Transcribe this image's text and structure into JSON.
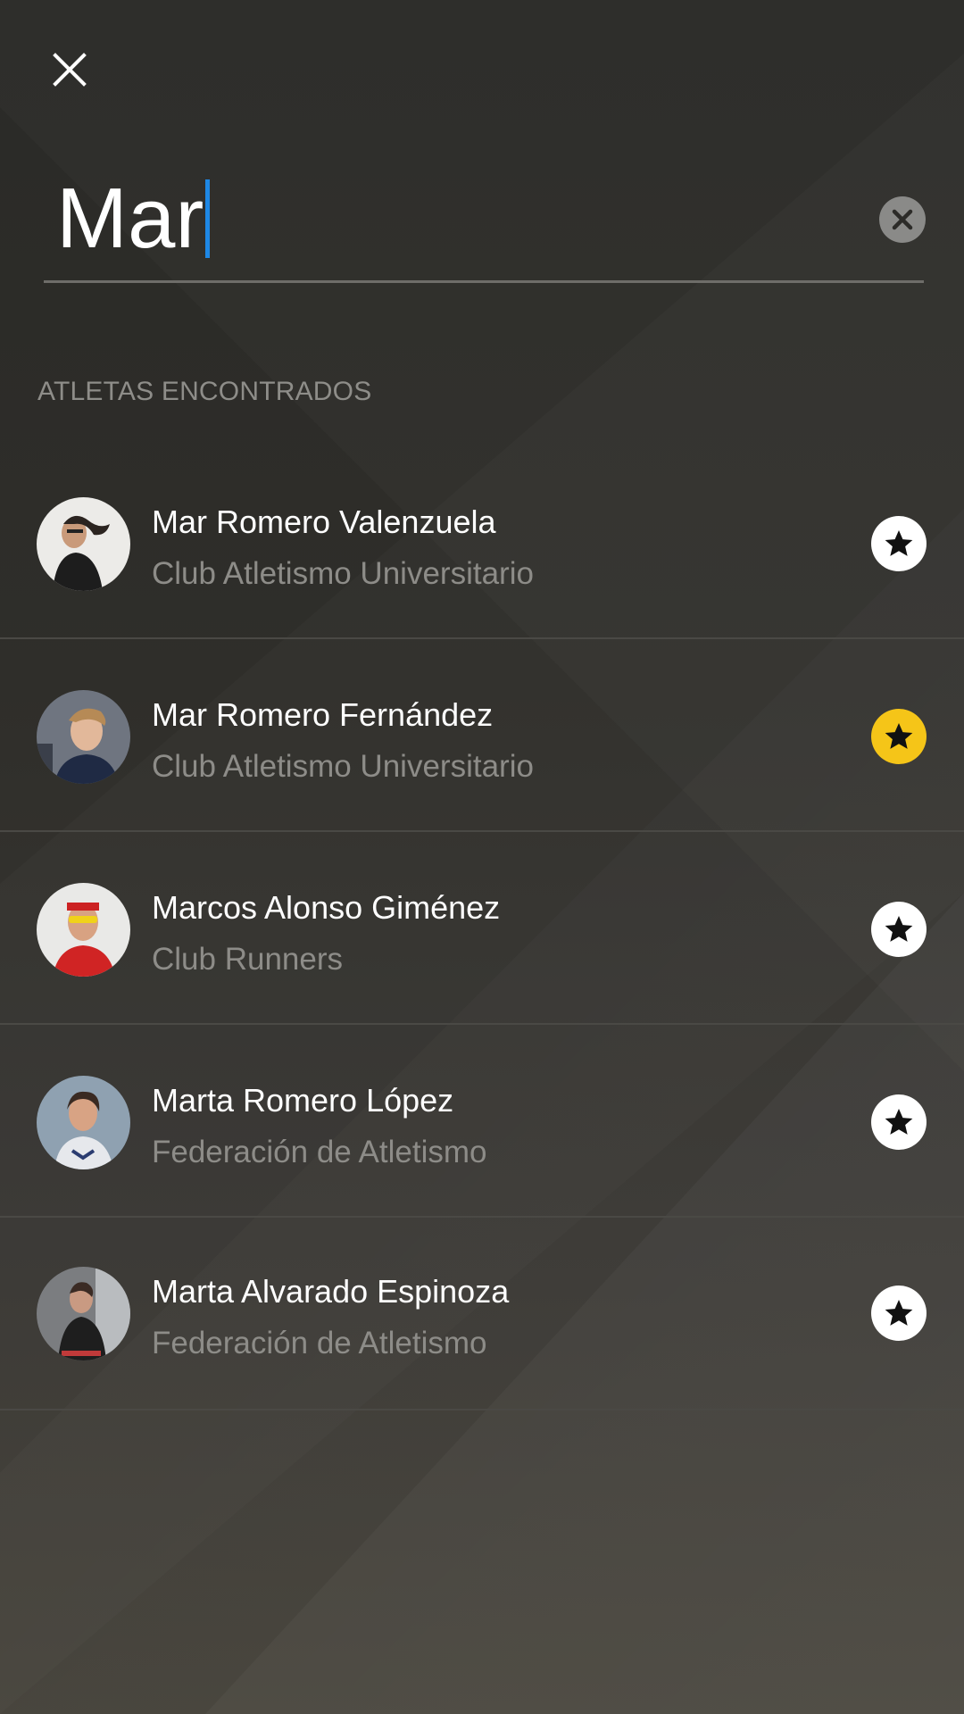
{
  "search": {
    "value": "Mar"
  },
  "section_title": "ATLETAS ENCONTRADOS",
  "athletes": [
    {
      "name": "Mar Romero Valenzuela",
      "club": "Club Atletismo Universitario",
      "favorite": false
    },
    {
      "name": "Mar Romero Fernández",
      "club": "Club Atletismo Universitario",
      "favorite": true
    },
    {
      "name": "Marcos Alonso Giménez",
      "club": "Club Runners",
      "favorite": false
    },
    {
      "name": "Marta Romero López",
      "club": "Federación de Atletismo",
      "favorite": false
    },
    {
      "name": "Marta Alvarado Espinoza",
      "club": "Federación de Atletismo",
      "favorite": false
    }
  ],
  "colors": {
    "accent_caret": "#1e88e5",
    "favorite_on": "#f5c518",
    "favorite_off": "#ffffff"
  },
  "icons": {
    "close": "close-icon",
    "clear": "clear-icon",
    "favorite": "star-icon"
  }
}
